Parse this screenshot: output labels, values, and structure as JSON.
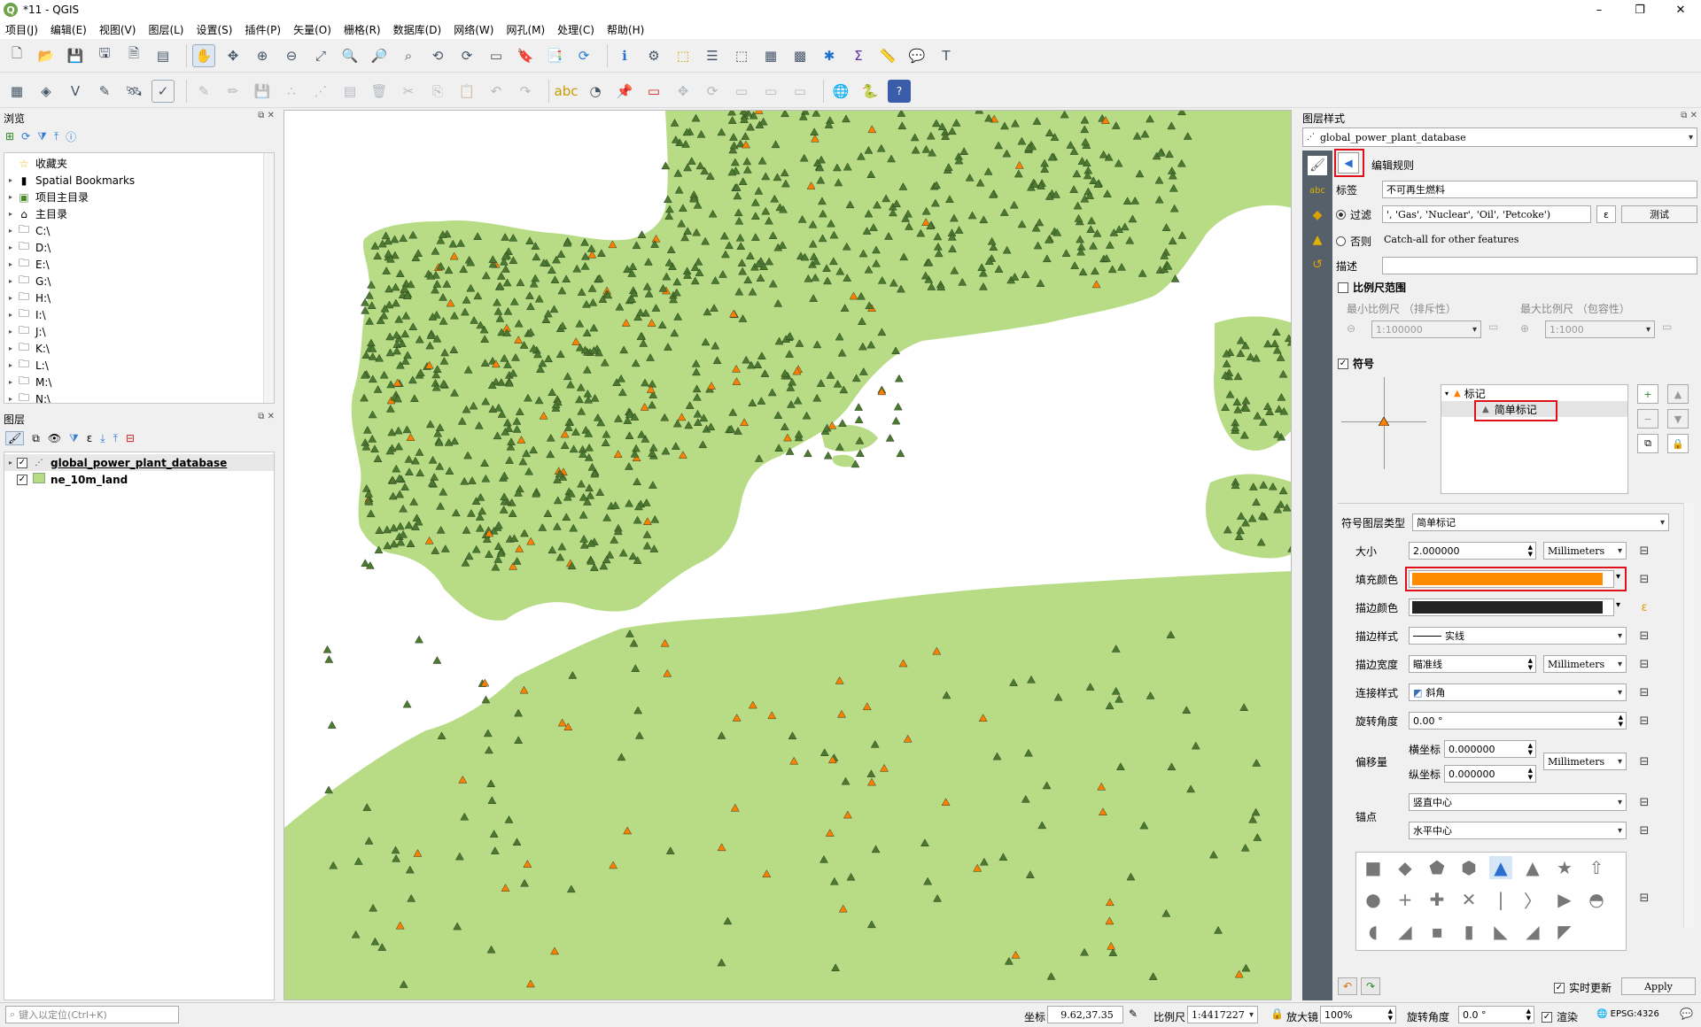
{
  "window": {
    "title": "*11 - QGIS",
    "logo": "Q",
    "controls": [
      "–",
      "❐",
      "✕"
    ]
  },
  "menu": [
    "项目(J)",
    "编辑(E)",
    "视图(V)",
    "图层(L)",
    "设置(S)",
    "插件(P)",
    "矢量(O)",
    "栅格(R)",
    "数据库(D)",
    "网络(W)",
    "网孔(M)",
    "处理(C)",
    "帮助(H)"
  ],
  "browser": {
    "title": "浏览",
    "items": [
      "收藏夹",
      "Spatial Bookmarks",
      "项目主目录",
      "主目录",
      "C:\\",
      "D:\\",
      "E:\\",
      "G:\\",
      "H:\\",
      "I:\\",
      "J:\\",
      "K:\\",
      "L:\\",
      "M:\\",
      "N:\\"
    ]
  },
  "layers": {
    "title": "图层",
    "items": [
      {
        "name": "global_power_plant_database",
        "checked": true,
        "bold": true
      },
      {
        "name": "ne_10m_land",
        "checked": true,
        "bold": true
      }
    ]
  },
  "style_panel": {
    "title": "图层样式",
    "layer_select": "global_power_plant_database",
    "edit_rule": "编辑规则",
    "label_label": "标签",
    "label_value": "不可再生燃料",
    "filter_label": "过滤",
    "filter_value": "', 'Gas', 'Nuclear', 'Oil', 'Petcoke')",
    "test_button": "测试",
    "else_label": "否则",
    "else_text": "Catch-all for other features",
    "desc_label": "描述",
    "desc_value": "",
    "scale_range": "比例尺范围",
    "min_scale_label": "最小比例尺 （排斥性）",
    "max_scale_label": "最大比例尺 （包容性）",
    "min_scale": "1:100000",
    "max_scale": "1:1000",
    "symbol_label": "符号",
    "tree_marker": "标记",
    "tree_simple": "简单标记",
    "layer_type_label": "符号图层类型",
    "layer_type": "简单标记",
    "size_label": "大小",
    "size": "2.000000",
    "unit": "Millimeters",
    "fill_label": "填充颜色",
    "fill_color": "#ff8c00",
    "stroke_color_label": "描边颜色",
    "stroke_color": "#232323",
    "stroke_style_label": "描边样式",
    "stroke_style": "实线",
    "stroke_width_label": "描边宽度",
    "stroke_width": "瞄准线",
    "join_label": "连接样式",
    "join": "斜角",
    "rotation_label": "旋转角度",
    "rotation": "0.00 °",
    "offset_label": "偏移量",
    "offset_x_label": "横坐标",
    "offset_y_label": "纵坐标",
    "offset_x": "0.000000",
    "offset_y": "0.000000",
    "anchor_label": "锚点",
    "anchor_v": "竖直中心",
    "anchor_h": "水平中心",
    "live_update": "实时更新",
    "apply": "Apply"
  },
  "status": {
    "locate_placeholder": "键入以定位(Ctrl+K)",
    "coord_label": "坐标",
    "coord": "9.62,37.35",
    "scale_label": "比例尺",
    "scale": "1:4417227",
    "magnifier_label": "放大镜",
    "magnifier": "100%",
    "rotation_label": "旋转角度",
    "rotation": "0.0 °",
    "render_label": "渲染",
    "crs": "EPSG:4326"
  },
  "colors": {
    "land": "#b7dc85",
    "plant_green": "#4a7a2e",
    "plant_orange": "#ff8000",
    "highlight": "#e0101a"
  }
}
